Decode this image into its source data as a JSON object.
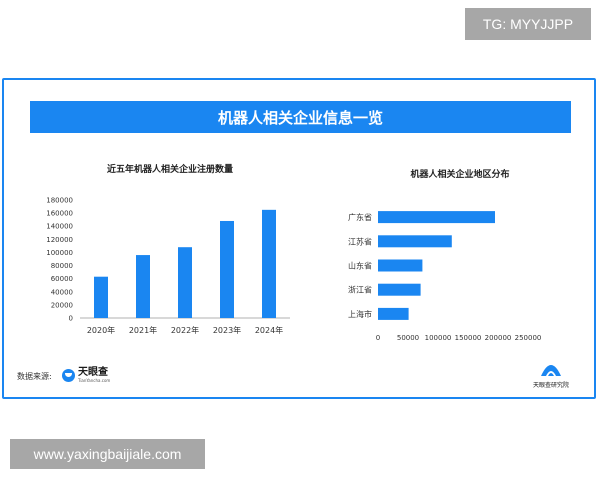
{
  "watermark_top": "TG: MYYJJPP",
  "watermark_bottom": "www.yaxingbaijiale.com",
  "banner_title": "机器人相关企业信息一览",
  "source_label": "数据来源:",
  "source_logo": {
    "name": "天眼查",
    "subtitle": "TianYancha.com",
    "icon": "tianyancha-logo-icon"
  },
  "institute_logo": {
    "name": "天眼查研究院",
    "icon": "tianyancha-institute-logo-icon"
  },
  "colors": {
    "accent": "#1a86f1",
    "bar": "#1a86f1",
    "text": "#333333",
    "badge": "#a7a7a7"
  },
  "chart_data": [
    {
      "type": "bar",
      "title": "近五年机器人相关企业注册数量",
      "categories": [
        "2020年",
        "2021年",
        "2022年",
        "2023年",
        "2024年"
      ],
      "values": [
        63000,
        96000,
        108000,
        148000,
        165000
      ],
      "yticks": [
        0,
        20000,
        40000,
        60000,
        80000,
        100000,
        120000,
        140000,
        160000,
        180000
      ],
      "ylim": [
        0,
        180000
      ],
      "grid": false,
      "legend": "none"
    },
    {
      "type": "bar",
      "orientation": "horizontal",
      "title": "机器人相关企业地区分布",
      "categories": [
        "广东省",
        "江苏省",
        "山东省",
        "浙江省",
        "上海市"
      ],
      "values": [
        195000,
        123000,
        74000,
        71000,
        51000
      ],
      "xticks": [
        0,
        50000,
        100000,
        150000,
        200000,
        250000
      ],
      "xlim": [
        0,
        250000
      ],
      "grid": false,
      "legend": "none"
    }
  ]
}
